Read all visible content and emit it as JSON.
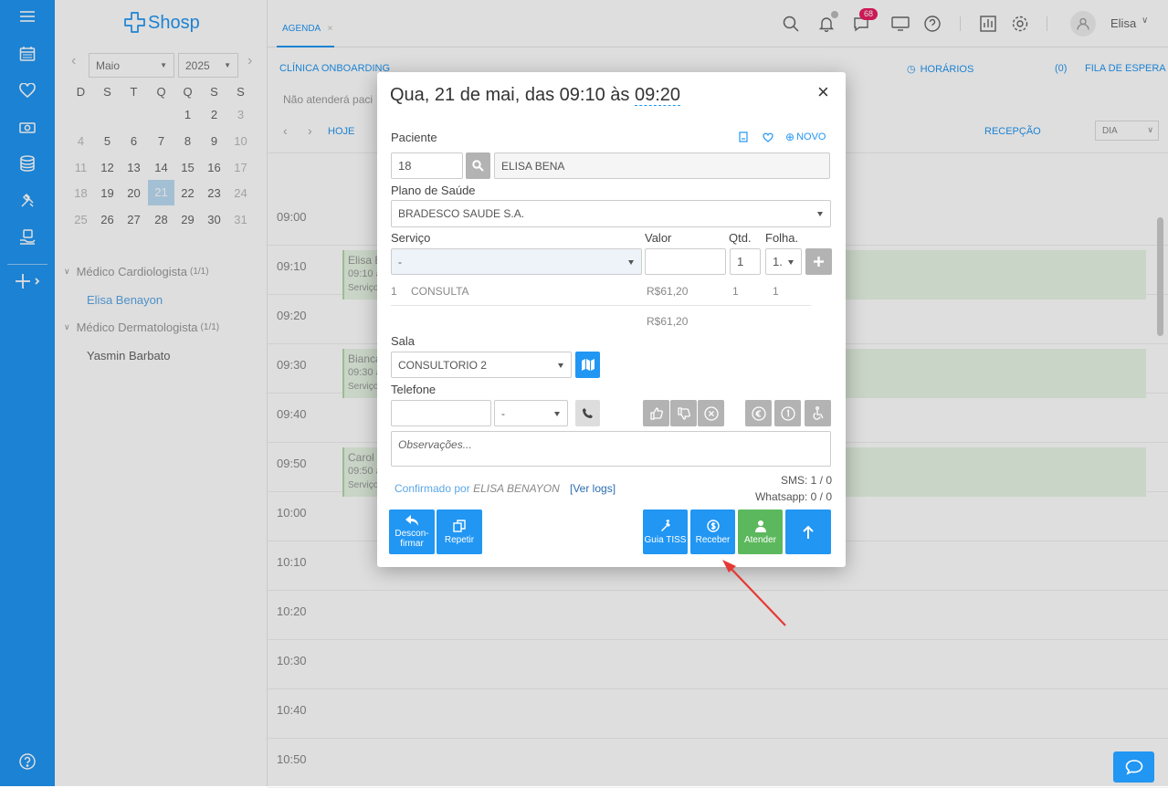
{
  "brand": {
    "name": "Shosp"
  },
  "tabs": [
    {
      "label": "AGENDA",
      "close": "×"
    }
  ],
  "topbar": {
    "notif_badge": "68",
    "user_name": "Elisa"
  },
  "calendar": {
    "month": "Maio",
    "year": "2025",
    "weekdays": [
      "D",
      "S",
      "T",
      "Q",
      "Q",
      "S",
      "S"
    ],
    "weeks": [
      [
        "",
        "",
        "",
        "",
        "1",
        "2",
        "3"
      ],
      [
        "4",
        "5",
        "6",
        "7",
        "8",
        "9",
        "10"
      ],
      [
        "11",
        "12",
        "13",
        "14",
        "15",
        "16",
        "17"
      ],
      [
        "18",
        "19",
        "20",
        "21",
        "22",
        "23",
        "24"
      ],
      [
        "25",
        "26",
        "27",
        "28",
        "29",
        "30",
        "31"
      ]
    ],
    "selected": "21"
  },
  "doctors": [
    {
      "group": "Médico Cardiologista",
      "count": "(1/1)",
      "name": "Elisa Benayon"
    },
    {
      "group": "Médico Dermatologista",
      "count": "(1/1)",
      "name": "Yasmin Barbato"
    }
  ],
  "agenda": {
    "clinic": "CLÍNICA ONBOARDING",
    "horarios": "HORÁRIOS",
    "queue_count": "(0)",
    "queue": "FILA DE ESPERA",
    "notice": "Não atenderá paci",
    "today": "HOJE",
    "reception": "RECEPÇÃO",
    "view_select": "DIA",
    "times": [
      "09:00",
      "09:10",
      "09:20",
      "09:30",
      "09:40",
      "09:50",
      "10:00",
      "10:10",
      "10:20",
      "10:30",
      "10:40",
      "10:50"
    ],
    "appointments": [
      {
        "name": "Elisa B",
        "time": "09:10 à",
        "service": "Serviço"
      },
      {
        "name": "Bianca",
        "time": "09:30 à",
        "service": "Serviço"
      },
      {
        "name": "Carol",
        "time": "09:50 à",
        "service": "Serviço"
      }
    ]
  },
  "modal": {
    "title_prefix": "Qua, 21 de mai, das 09:10 às ",
    "title_end": "09:20",
    "patient_label": "Paciente",
    "new_link": "NOVO",
    "patient_id": "18",
    "patient_name": "ELISA BENA",
    "plan_label": "Plano de Saúde",
    "plan_value": "BRADESCO SAUDE S.A.",
    "service_label": "Serviço",
    "value_label": "Valor",
    "qty_label": "Qtd.",
    "sheet_label": "Folha.",
    "service_value": "-",
    "qty_value": "1",
    "sheet_value": "1.",
    "service_row": {
      "n": "1",
      "name": "CONSULTA",
      "value": "R$61,20",
      "qty": "1",
      "sheet": "1"
    },
    "total": "R$61,20",
    "room_label": "Sala",
    "room_value": "CONSULTORIO 2",
    "phone_label": "Telefone",
    "phone_type": "-",
    "obs_placeholder": "Observações...",
    "confirmed_prefix": "Confirmado por",
    "confirmed_by": "ELISA BENAYON",
    "logs_link": "[Ver logs]",
    "sms": "SMS: 1 / 0",
    "whatsapp": "Whatsapp: 0 / 0",
    "buttons": {
      "unconfirm_1": "Descon-",
      "unconfirm_2": "firmar",
      "repeat": "Repetir",
      "tiss": "Guia TISS",
      "receive": "Receber",
      "attend": "Atender"
    }
  },
  "colors": {
    "primary": "#2196f3",
    "green": "#5cb85c",
    "selected_day": "#bcdcf4",
    "appointment_bg": "#e7f5e4",
    "annotation_arrow": "#e53935"
  }
}
